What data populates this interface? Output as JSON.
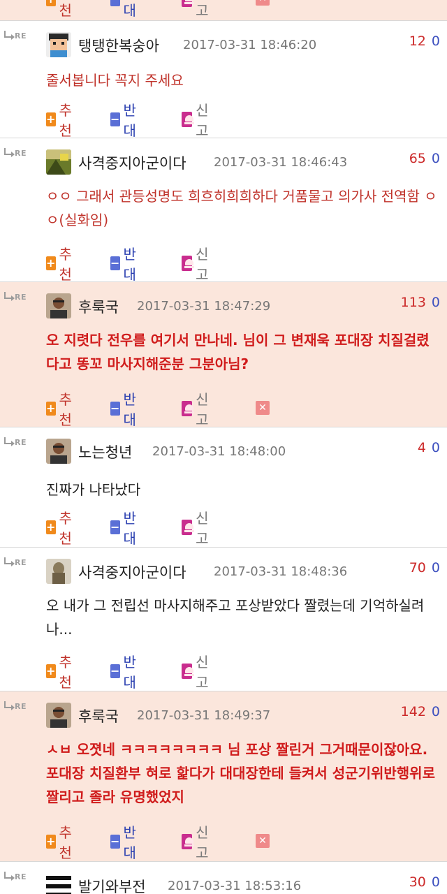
{
  "labels": {
    "re": "RE",
    "recommend": "추천",
    "oppose": "반대",
    "report": "신고",
    "plus_glyph": "+",
    "minus_glyph": "−",
    "close_glyph": "✕"
  },
  "top_partial_row": {
    "recommend": "추천",
    "oppose": "반대",
    "report": "신고"
  },
  "comments": [
    {
      "nickname": "탱탱한복숭아",
      "datetime": "2017-03-31 18:46:20",
      "upvotes": "12",
      "downvotes": "0",
      "text": "줄서봅니다 꼭지 주세요",
      "highlighted": false,
      "bold": false,
      "avatar_icon": "pixel-character-icon",
      "show_delete": false
    },
    {
      "nickname": "사격중지아군이다",
      "datetime": "2017-03-31 18:46:43",
      "upvotes": "65",
      "downvotes": "0",
      "text": "ㅇㅇ 그래서 관등성명도 희흐히희희하다 거품물고 의가사 전역함 ㅇㅇ(실화임)",
      "highlighted": false,
      "bold": false,
      "avatar_icon": "scenery-photo-icon",
      "show_delete": false
    },
    {
      "nickname": "후룩국",
      "datetime": "2017-03-31 18:47:29",
      "upvotes": "113",
      "downvotes": "0",
      "text": "오 지렷다 전우를 여기서 만나네. 님이 그 변재욱 포대장 치질걸렸다고 똥꼬 마사지해준분 그분아님?",
      "highlighted": true,
      "bold": true,
      "avatar_icon": "person-photo-icon",
      "show_delete": true
    },
    {
      "nickname": "노는청년",
      "datetime": "2017-03-31 18:48:00",
      "upvotes": "4",
      "downvotes": "0",
      "text": "진짜가 나타났다",
      "highlighted": false,
      "bold": false,
      "plain": true,
      "avatar_icon": "person-photo-icon",
      "show_delete": false
    },
    {
      "nickname": "사격중지아군이다",
      "datetime": "2017-03-31 18:48:36",
      "upvotes": "70",
      "downvotes": "0",
      "text": "오 내가 그 전립선 마사지해주고 포상받았다 짤렸는데 기억하실려나...",
      "highlighted": false,
      "bold": false,
      "plain": true,
      "avatar_icon": "statue-photo-icon",
      "show_delete": false
    },
    {
      "nickname": "후룩국",
      "datetime": "2017-03-31 18:49:37",
      "upvotes": "142",
      "downvotes": "0",
      "text": "ㅅㅂ 오졋네 ㅋㅋㅋㅋㅋㅋㅋㅋ 님 포상 짤린거 그거때문이잖아요. 포대장 치질환부 혀로 핥다가 대대장한테 들켜서 성군기위반행위로 짤리고 졸라 유명했었지",
      "highlighted": true,
      "bold": true,
      "avatar_icon": "person-photo-icon",
      "show_delete": true
    },
    {
      "nickname": "발기와부전",
      "datetime": "2017-03-31 18:53:16",
      "upvotes": "30",
      "downvotes": "0",
      "text": "",
      "highlighted": false,
      "bold": false,
      "avatar_icon": "stripes-icon",
      "show_delete": false
    }
  ],
  "colors": {
    "highlight_bg": "#fbe6dc",
    "upvote": "#cc2a2a",
    "downvote": "#3c4fbf",
    "text_red": "#c0332b"
  }
}
